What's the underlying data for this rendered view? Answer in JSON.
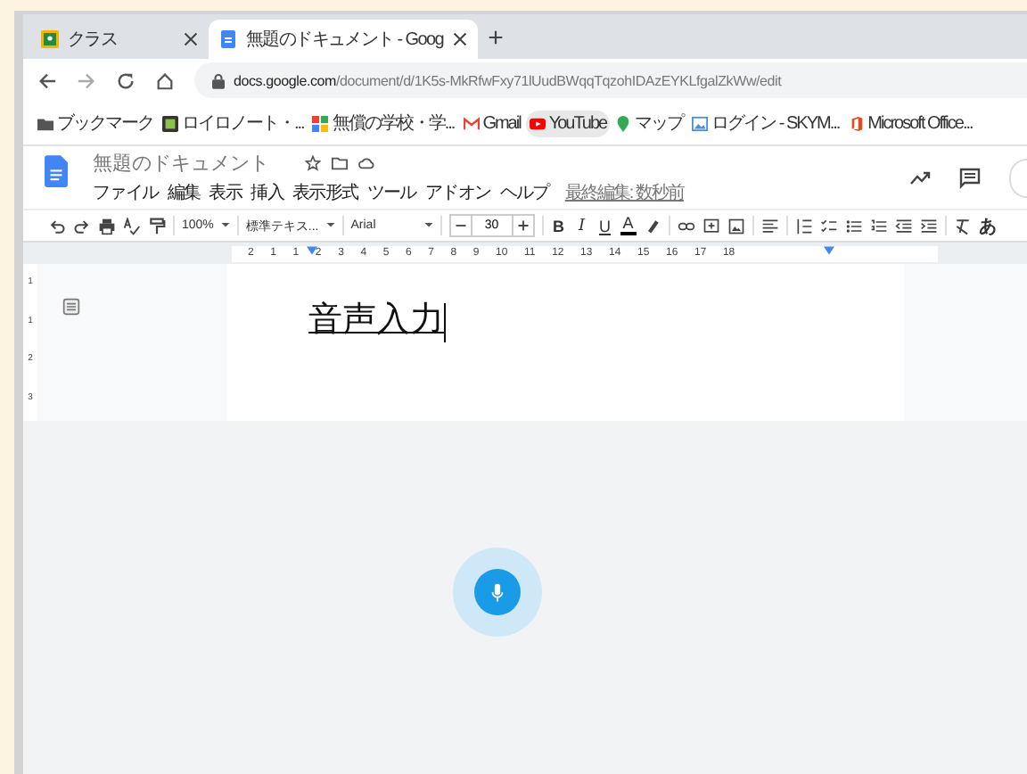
{
  "tabs": [
    {
      "title": "クラス",
      "selected": false
    },
    {
      "title": "無題のドキュメント - Goog",
      "selected": true
    }
  ],
  "new_tab": "+",
  "address": {
    "host": "docs.google.com",
    "path": "/document/d/1K5s-MkRfwFxy71lUudBWqqTqzohIDAzEYKLfgalZkWw/edit"
  },
  "bookmarks": [
    {
      "label": "ブックマーク",
      "selected": false
    },
    {
      "label": "ロイロノート・...",
      "selected": false
    },
    {
      "label": "無償の学校・学...",
      "selected": false
    },
    {
      "label": "Gmail",
      "selected": false
    },
    {
      "label": "YouTube",
      "selected": true
    },
    {
      "label": "マップ",
      "selected": false
    },
    {
      "label": "ログイン - SKYM...",
      "selected": false
    },
    {
      "label": "Microsoft Office...",
      "selected": false
    }
  ],
  "document": {
    "title": "無題のドキュメント",
    "menu": [
      "ファイル",
      "編集",
      "表示",
      "挿入",
      "表示形式",
      "ツール",
      "アドオン",
      "ヘルプ"
    ],
    "last_edit": "最終編集: 数秒前"
  },
  "toolbar": {
    "zoom": "100%",
    "style": "標準テキス...",
    "font": "Arial",
    "font_size": "30",
    "format_letters": [
      "B",
      "I",
      "U",
      "A"
    ],
    "input_tool": "あ"
  },
  "ruler": [
    "2",
    "1",
    "1",
    "2",
    "3",
    "4",
    "5",
    "6",
    "7",
    "8",
    "9",
    "10",
    "11",
    "12",
    "13",
    "14",
    "15",
    "16",
    "17",
    "18"
  ],
  "vertical_ruler": [
    "1",
    "1",
    "2",
    "3"
  ],
  "body_text": "音声入力",
  "voice_input": {
    "on": true
  }
}
